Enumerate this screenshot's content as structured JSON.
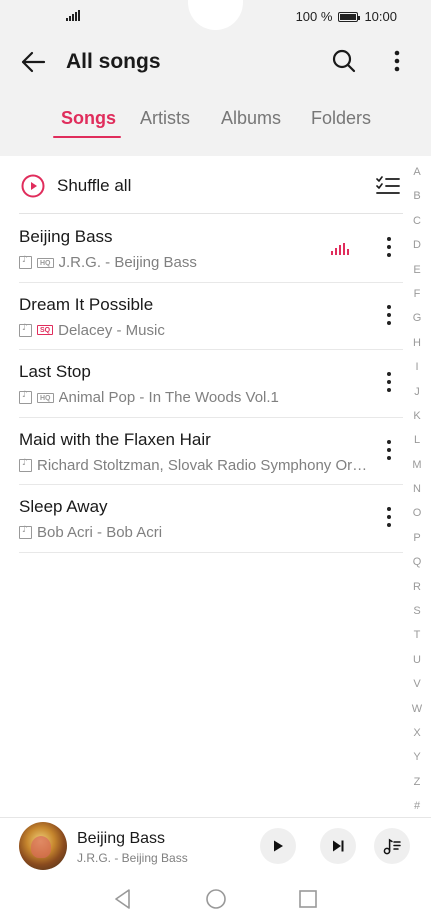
{
  "status_bar": {
    "battery_text": "100 %",
    "time": "10:00"
  },
  "header": {
    "title": "All songs"
  },
  "tabs": [
    {
      "label": "Songs",
      "active": true
    },
    {
      "label": "Artists",
      "active": false
    },
    {
      "label": "Albums",
      "active": false
    },
    {
      "label": "Folders",
      "active": false
    }
  ],
  "shuffle": {
    "label": "Shuffle all"
  },
  "songs": [
    {
      "title": "Beijing Bass",
      "quality": "HQ",
      "subtitle": "J.R.G. - Beijing Bass",
      "playing": true
    },
    {
      "title": "Dream It Possible",
      "quality": "SQ",
      "subtitle": "Delacey - Music",
      "playing": false
    },
    {
      "title": "Last Stop",
      "quality": "HQ",
      "subtitle": "Animal Pop - In The Woods Vol.1",
      "playing": false
    },
    {
      "title": "Maid with the Flaxen Hair",
      "quality": "",
      "subtitle": "Richard Stoltzman, Slovak Radio Symphony Or…",
      "playing": false
    },
    {
      "title": "Sleep Away",
      "quality": "",
      "subtitle": "Bob Acri - Bob Acri",
      "playing": false
    }
  ],
  "index_letters": [
    "A",
    "B",
    "C",
    "D",
    "E",
    "F",
    "G",
    "H",
    "I",
    "J",
    "K",
    "L",
    "M",
    "N",
    "O",
    "P",
    "Q",
    "R",
    "S",
    "T",
    "U",
    "V",
    "W",
    "X",
    "Y",
    "Z",
    "#"
  ],
  "mini_player": {
    "title": "Beijing Bass",
    "subtitle": "J.R.G. - Beijing Bass"
  },
  "colors": {
    "accent": "#e02d5c",
    "header_bg": "#f2f2f2"
  }
}
